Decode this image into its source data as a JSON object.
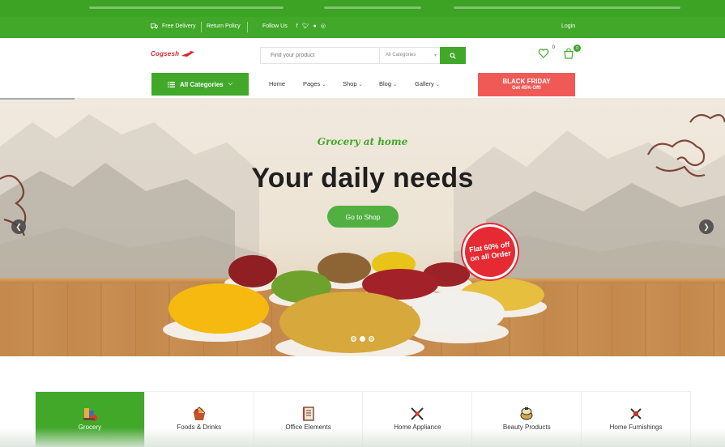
{
  "topbar": {
    "free_delivery": "Free Delivery",
    "return_policy": "Return Policy",
    "follow_us": "Follow Us",
    "social_icons": [
      "facebook-icon",
      "twitter-icon",
      "pinterest-icon",
      "instagram-icon"
    ],
    "login": "Login"
  },
  "header": {
    "logo_text": "Cogsesh",
    "search_placeholder": "Find your product",
    "category_select": "All Categories",
    "wishlist_count": "0",
    "cart_count": "0"
  },
  "nav": {
    "all_categories": "All Categories",
    "items": [
      {
        "label": "Home",
        "has_dropdown": false
      },
      {
        "label": "Pages",
        "has_dropdown": true
      },
      {
        "label": "Shop",
        "has_dropdown": true
      },
      {
        "label": "Blog",
        "has_dropdown": true
      },
      {
        "label": "Gallery",
        "has_dropdown": true
      }
    ],
    "promo_title": "BLACK FRIDAY",
    "promo_sub": "Get 45% Off!"
  },
  "hero": {
    "tagline": "Grocery at home",
    "headline": "Your daily needs",
    "button": "Go to Shop",
    "badge_line1": "Flat 60% off",
    "badge_line2": "on all Order",
    "active_slide": 1,
    "slide_count": 3
  },
  "categories": [
    {
      "label": "Grocery",
      "active": true,
      "icon": "grocery-icon"
    },
    {
      "label": "Foods & Drinks",
      "active": false,
      "icon": "foods-drinks-icon"
    },
    {
      "label": "Office Elements",
      "active": false,
      "icon": "office-elements-icon"
    },
    {
      "label": "Home Appliance",
      "active": false,
      "icon": "home-appliance-icon"
    },
    {
      "label": "Beauty Products",
      "active": false,
      "icon": "beauty-products-icon"
    },
    {
      "label": "Home Furnishings",
      "active": false,
      "icon": "home-furnishings-icon"
    }
  ],
  "colors": {
    "brand_green": "#41a82a",
    "promo_red": "#ef5a57",
    "badge_red": "#e62a33"
  }
}
